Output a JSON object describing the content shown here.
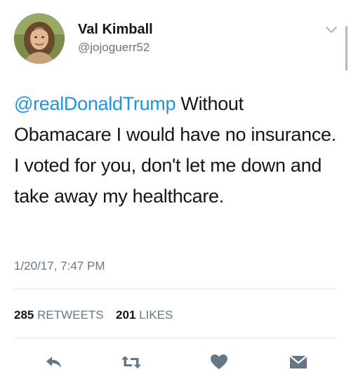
{
  "user": {
    "display_name": "Val Kimball",
    "handle": "@jojoguerr52"
  },
  "tweet": {
    "mention": "@realDonaldTrump",
    "body": " Without Obamacare I would have no insurance. I voted for you, don't let me down and take away my healthcare.",
    "timestamp": "1/20/17, 7:47 PM"
  },
  "stats": {
    "retweets_count": "285",
    "retweets_label": "RETWEETS",
    "likes_count": "201",
    "likes_label": "LIKES"
  },
  "icons": {
    "caret": "chevron-down-icon",
    "reply": "reply-icon",
    "retweet": "retweet-icon",
    "like": "heart-icon",
    "dm": "envelope-icon"
  },
  "colors": {
    "mention": "#1b95e0",
    "secondary_text": "#657786",
    "icon": "#8899a6"
  }
}
